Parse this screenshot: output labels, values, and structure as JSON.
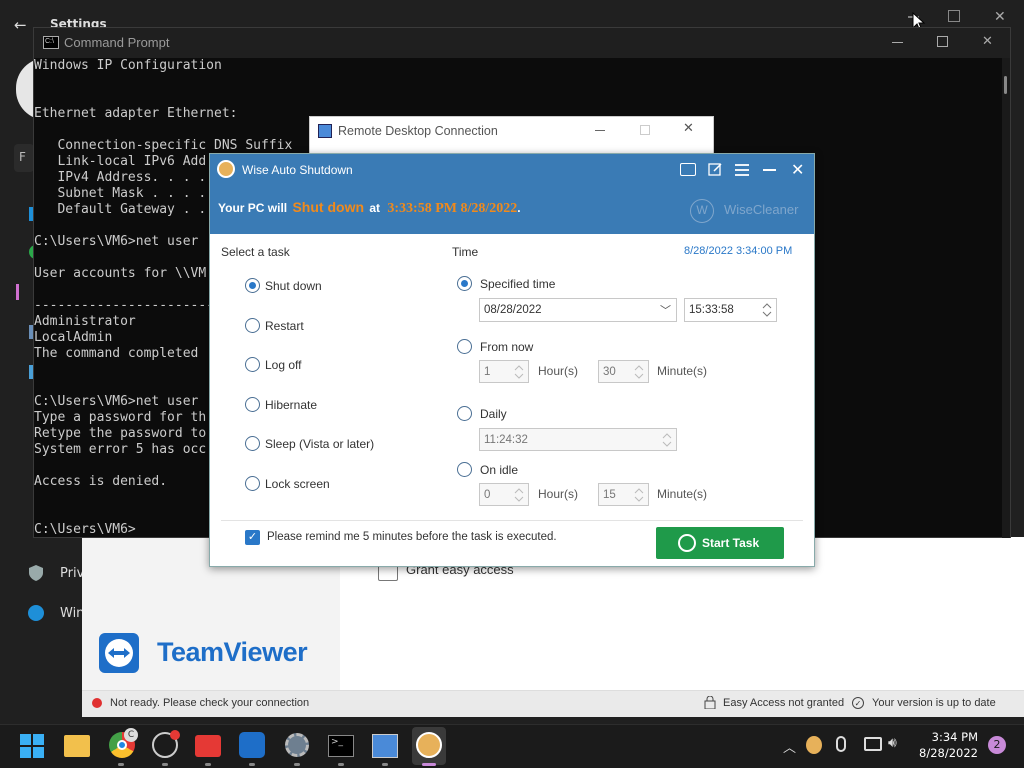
{
  "settings": {
    "title": "Settings",
    "side_items": [
      "Priv",
      "Win"
    ],
    "grant_label": "Grant easy access"
  },
  "teamviewer": {
    "brand": "TeamViewer",
    "status_text": "Not ready. Please check your connection",
    "easy_access": "Easy Access not granted",
    "version": "Your version is up to date",
    "colors": {
      "brand": "#1e6ec8",
      "status_error": "#e03030"
    }
  },
  "cmd": {
    "title": "Command Prompt",
    "lines": [
      "Windows IP Configuration",
      "",
      "",
      "Ethernet adapter Ethernet:",
      "",
      "   Connection-specific DNS Suffix",
      "   Link-local IPv6 Add",
      "   IPv4 Address. . . .",
      "   Subnet Mask . . . .",
      "   Default Gateway . .",
      "",
      "C:\\Users\\VM6>net user",
      "",
      "User accounts for \\\\VM",
      "",
      "-------------------------",
      "Administrator",
      "LocalAdmin",
      "The command completed",
      "",
      "",
      "C:\\Users\\VM6>net user",
      "Type a password for th",
      "Retype the password to",
      "System error 5 has occ",
      "",
      "Access is denied.",
      "",
      "",
      "C:\\Users\\VM6>"
    ]
  },
  "rdc": {
    "title": "Remote Desktop Connection"
  },
  "wise": {
    "title": "Wise Auto Shutdown",
    "banner": {
      "prefix": "Your PC will",
      "action": "Shut down",
      "at": "at",
      "datetime": "3:33:58 PM 8/28/2022",
      "period": ".",
      "brand": "WiseCleaner",
      "colors": {
        "accent": "#f08a1c",
        "bg": "#3a7bb5"
      }
    },
    "task_header": "Select a task",
    "tasks": [
      "Shut down",
      "Restart",
      "Log off",
      "Hibernate",
      "Sleep (Vista or later)",
      "Lock screen"
    ],
    "selected_task": "Shut down",
    "time_header": "Time",
    "current_time": "8/28/2022 3:34:00 PM",
    "time_options": {
      "specified": {
        "label": "Specified time",
        "date": "08/28/2022",
        "time": "15:33:58"
      },
      "from_now": {
        "label": "From now",
        "hours": "1",
        "hours_label": "Hour(s)",
        "minutes": "30",
        "minutes_label": "Minute(s)"
      },
      "daily": {
        "label": "Daily",
        "time": "11:24:32"
      },
      "on_idle": {
        "label": "On idle",
        "hours": "0",
        "hours_label": "Hour(s)",
        "minutes": "15",
        "minutes_label": "Minute(s)"
      }
    },
    "remind_label": "Please remind me 5 minutes before the task is executed.",
    "remind_checked": true,
    "start_button": "Start Task",
    "colors": {
      "start": "#1f9a4a",
      "link": "#2a78c8"
    }
  },
  "taskbar": {
    "time": "3:34 PM",
    "date": "8/28/2022",
    "notification_count": "2",
    "chrome_badge": "C"
  }
}
